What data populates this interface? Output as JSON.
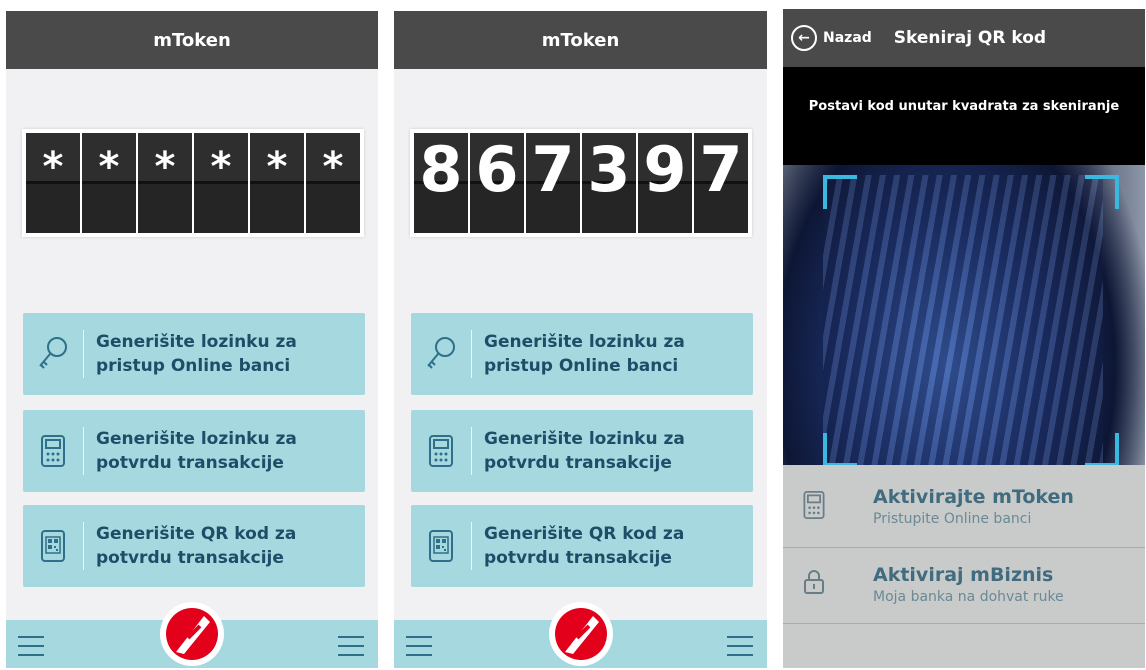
{
  "screens": [
    {
      "title": "mToken",
      "digits": [
        "*",
        "*",
        "*",
        "*",
        "*",
        "*"
      ],
      "actions": [
        {
          "icon": "key-icon",
          "line1": "Generišite lozinku za",
          "line2": "pristup Online banci"
        },
        {
          "icon": "calculator-icon",
          "line1": "Generišite lozinku za",
          "line2": "potvrdu transakcije"
        },
        {
          "icon": "qr-code-icon",
          "line1": "Generišite QR kod za",
          "line2": "potvrdu transakcije"
        }
      ]
    },
    {
      "title": "mToken",
      "digits": [
        "8",
        "6",
        "7",
        "3",
        "9",
        "7"
      ],
      "actions": [
        {
          "icon": "key-icon",
          "line1": "Generišite lozinku za",
          "line2": "pristup Online banci"
        },
        {
          "icon": "calculator-icon",
          "line1": "Generišite lozinku za",
          "line2": "potvrdu transakcije"
        },
        {
          "icon": "qr-code-icon",
          "line1": "Generišite QR kod za",
          "line2": "potvrdu transakcije"
        }
      ]
    }
  ],
  "scanner": {
    "back_label": "Nazad",
    "title": "Skeniraj QR kod",
    "instruction": "Postavi kod unutar kvadrata za skeniranje",
    "items": [
      {
        "icon": "calculator-icon",
        "title": "Aktivirajte mToken",
        "subtitle": "Pristupite Online banci"
      },
      {
        "icon": "lock-icon",
        "title": "Aktiviraj mBiznis",
        "subtitle": "Moja banka na dohvat ruke"
      }
    ]
  },
  "colors": {
    "topbar": "#4a4a4a",
    "action_bg": "#a6d9df",
    "action_text": "#1e4d68",
    "logo_red": "#e2001a",
    "scan_corner": "#3ab8e0"
  }
}
